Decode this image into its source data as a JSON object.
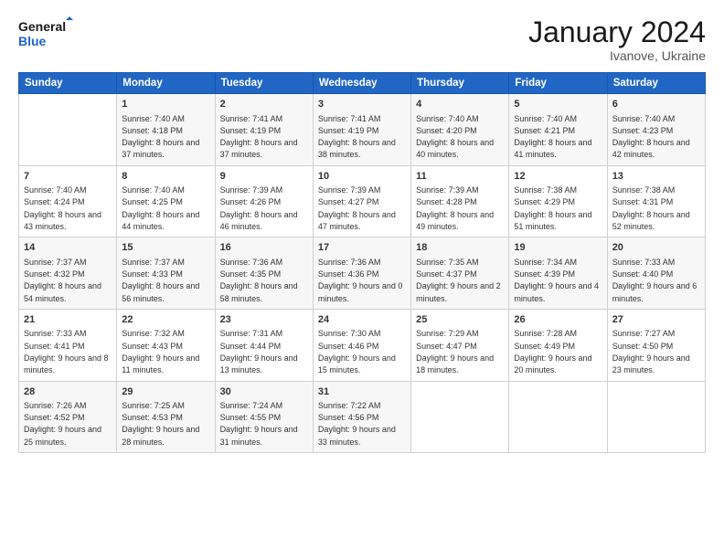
{
  "header": {
    "logo_line1": "General",
    "logo_line2": "Blue",
    "title": "January 2024",
    "subtitle": "Ivanove, Ukraine"
  },
  "columns": [
    "Sunday",
    "Monday",
    "Tuesday",
    "Wednesday",
    "Thursday",
    "Friday",
    "Saturday"
  ],
  "weeks": [
    [
      {
        "day": "",
        "sunrise": "",
        "sunset": "",
        "daylight": ""
      },
      {
        "day": "1",
        "sunrise": "Sunrise: 7:40 AM",
        "sunset": "Sunset: 4:18 PM",
        "daylight": "Daylight: 8 hours and 37 minutes."
      },
      {
        "day": "2",
        "sunrise": "Sunrise: 7:41 AM",
        "sunset": "Sunset: 4:19 PM",
        "daylight": "Daylight: 8 hours and 37 minutes."
      },
      {
        "day": "3",
        "sunrise": "Sunrise: 7:41 AM",
        "sunset": "Sunset: 4:19 PM",
        "daylight": "Daylight: 8 hours and 38 minutes."
      },
      {
        "day": "4",
        "sunrise": "Sunrise: 7:40 AM",
        "sunset": "Sunset: 4:20 PM",
        "daylight": "Daylight: 8 hours and 40 minutes."
      },
      {
        "day": "5",
        "sunrise": "Sunrise: 7:40 AM",
        "sunset": "Sunset: 4:21 PM",
        "daylight": "Daylight: 8 hours and 41 minutes."
      },
      {
        "day": "6",
        "sunrise": "Sunrise: 7:40 AM",
        "sunset": "Sunset: 4:23 PM",
        "daylight": "Daylight: 8 hours and 42 minutes."
      }
    ],
    [
      {
        "day": "7",
        "sunrise": "Sunrise: 7:40 AM",
        "sunset": "Sunset: 4:24 PM",
        "daylight": "Daylight: 8 hours and 43 minutes."
      },
      {
        "day": "8",
        "sunrise": "Sunrise: 7:40 AM",
        "sunset": "Sunset: 4:25 PM",
        "daylight": "Daylight: 8 hours and 44 minutes."
      },
      {
        "day": "9",
        "sunrise": "Sunrise: 7:39 AM",
        "sunset": "Sunset: 4:26 PM",
        "daylight": "Daylight: 8 hours and 46 minutes."
      },
      {
        "day": "10",
        "sunrise": "Sunrise: 7:39 AM",
        "sunset": "Sunset: 4:27 PM",
        "daylight": "Daylight: 8 hours and 47 minutes."
      },
      {
        "day": "11",
        "sunrise": "Sunrise: 7:39 AM",
        "sunset": "Sunset: 4:28 PM",
        "daylight": "Daylight: 8 hours and 49 minutes."
      },
      {
        "day": "12",
        "sunrise": "Sunrise: 7:38 AM",
        "sunset": "Sunset: 4:29 PM",
        "daylight": "Daylight: 8 hours and 51 minutes."
      },
      {
        "day": "13",
        "sunrise": "Sunrise: 7:38 AM",
        "sunset": "Sunset: 4:31 PM",
        "daylight": "Daylight: 8 hours and 52 minutes."
      }
    ],
    [
      {
        "day": "14",
        "sunrise": "Sunrise: 7:37 AM",
        "sunset": "Sunset: 4:32 PM",
        "daylight": "Daylight: 8 hours and 54 minutes."
      },
      {
        "day": "15",
        "sunrise": "Sunrise: 7:37 AM",
        "sunset": "Sunset: 4:33 PM",
        "daylight": "Daylight: 8 hours and 56 minutes."
      },
      {
        "day": "16",
        "sunrise": "Sunrise: 7:36 AM",
        "sunset": "Sunset: 4:35 PM",
        "daylight": "Daylight: 8 hours and 58 minutes."
      },
      {
        "day": "17",
        "sunrise": "Sunrise: 7:36 AM",
        "sunset": "Sunset: 4:36 PM",
        "daylight": "Daylight: 9 hours and 0 minutes."
      },
      {
        "day": "18",
        "sunrise": "Sunrise: 7:35 AM",
        "sunset": "Sunset: 4:37 PM",
        "daylight": "Daylight: 9 hours and 2 minutes."
      },
      {
        "day": "19",
        "sunrise": "Sunrise: 7:34 AM",
        "sunset": "Sunset: 4:39 PM",
        "daylight": "Daylight: 9 hours and 4 minutes."
      },
      {
        "day": "20",
        "sunrise": "Sunrise: 7:33 AM",
        "sunset": "Sunset: 4:40 PM",
        "daylight": "Daylight: 9 hours and 6 minutes."
      }
    ],
    [
      {
        "day": "21",
        "sunrise": "Sunrise: 7:33 AM",
        "sunset": "Sunset: 4:41 PM",
        "daylight": "Daylight: 9 hours and 8 minutes."
      },
      {
        "day": "22",
        "sunrise": "Sunrise: 7:32 AM",
        "sunset": "Sunset: 4:43 PM",
        "daylight": "Daylight: 9 hours and 11 minutes."
      },
      {
        "day": "23",
        "sunrise": "Sunrise: 7:31 AM",
        "sunset": "Sunset: 4:44 PM",
        "daylight": "Daylight: 9 hours and 13 minutes."
      },
      {
        "day": "24",
        "sunrise": "Sunrise: 7:30 AM",
        "sunset": "Sunset: 4:46 PM",
        "daylight": "Daylight: 9 hours and 15 minutes."
      },
      {
        "day": "25",
        "sunrise": "Sunrise: 7:29 AM",
        "sunset": "Sunset: 4:47 PM",
        "daylight": "Daylight: 9 hours and 18 minutes."
      },
      {
        "day": "26",
        "sunrise": "Sunrise: 7:28 AM",
        "sunset": "Sunset: 4:49 PM",
        "daylight": "Daylight: 9 hours and 20 minutes."
      },
      {
        "day": "27",
        "sunrise": "Sunrise: 7:27 AM",
        "sunset": "Sunset: 4:50 PM",
        "daylight": "Daylight: 9 hours and 23 minutes."
      }
    ],
    [
      {
        "day": "28",
        "sunrise": "Sunrise: 7:26 AM",
        "sunset": "Sunset: 4:52 PM",
        "daylight": "Daylight: 9 hours and 25 minutes."
      },
      {
        "day": "29",
        "sunrise": "Sunrise: 7:25 AM",
        "sunset": "Sunset: 4:53 PM",
        "daylight": "Daylight: 9 hours and 28 minutes."
      },
      {
        "day": "30",
        "sunrise": "Sunrise: 7:24 AM",
        "sunset": "Sunset: 4:55 PM",
        "daylight": "Daylight: 9 hours and 31 minutes."
      },
      {
        "day": "31",
        "sunrise": "Sunrise: 7:22 AM",
        "sunset": "Sunset: 4:56 PM",
        "daylight": "Daylight: 9 hours and 33 minutes."
      },
      {
        "day": "",
        "sunrise": "",
        "sunset": "",
        "daylight": ""
      },
      {
        "day": "",
        "sunrise": "",
        "sunset": "",
        "daylight": ""
      },
      {
        "day": "",
        "sunrise": "",
        "sunset": "",
        "daylight": ""
      }
    ]
  ]
}
